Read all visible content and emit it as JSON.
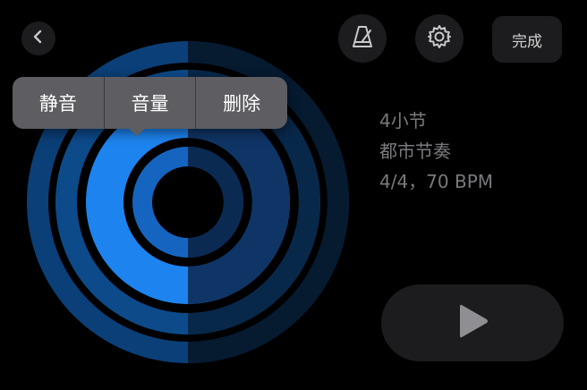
{
  "header": {
    "back_icon": "chevron-left-icon",
    "metronome_icon": "metronome-icon",
    "settings_icon": "gear-icon",
    "done_label": "完成"
  },
  "popup_menu": {
    "items": [
      {
        "label": "静音"
      },
      {
        "label": "音量"
      },
      {
        "label": "删除"
      }
    ]
  },
  "loop_info": {
    "bars": "4小节",
    "pattern": "都市节奏",
    "tempo": "4/4，70 BPM"
  },
  "transport": {
    "play_icon": "play-icon"
  },
  "colors": {
    "background": "#000000",
    "accent": "#1d84ef",
    "ring_dim": "#0a3a70",
    "button_bg": "#1c1c1e",
    "popup_bg": "#5d5d62"
  }
}
